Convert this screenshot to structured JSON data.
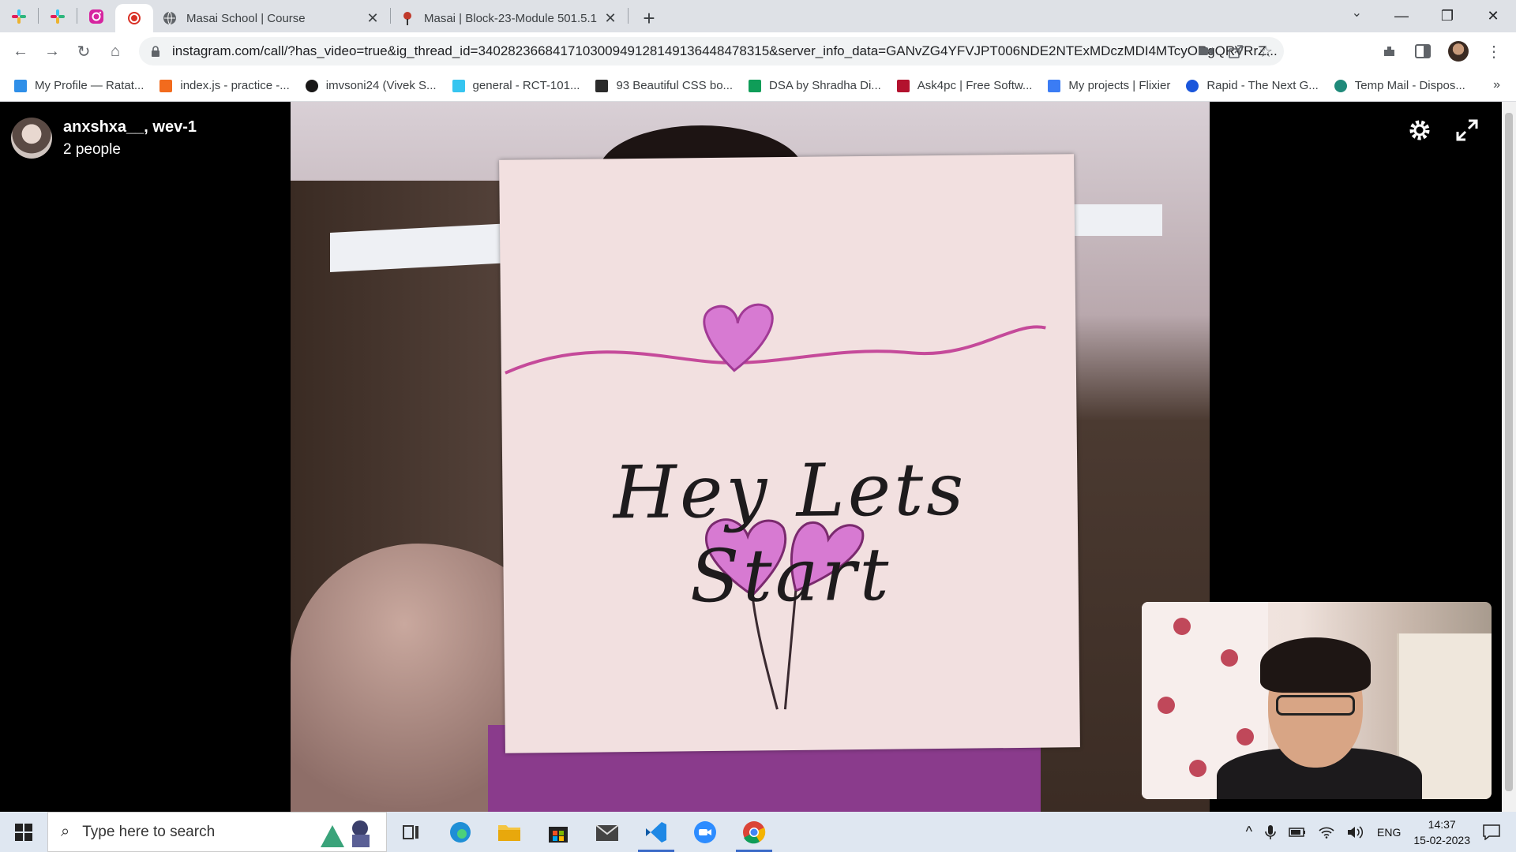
{
  "browser": {
    "tabs": [
      {
        "label": "Masai School | Course",
        "close": "✕"
      },
      {
        "label": "Masai | Block-23-Module 501.5.1",
        "close": "✕"
      }
    ],
    "new_tab": "+",
    "url": "instagram.com/call/?has_video=true&ig_thread_id=340282366841710300949128149136448478315&server_info_data=GANvZG4YFVJPT006NDE2NTExMDczMDI4MTcyORgQRVRrZ...",
    "bookmarks": [
      {
        "label": "My Profile — Ratat...",
        "color": "#2f8fe8"
      },
      {
        "label": "index.js - practice -...",
        "color": "#f26b1d"
      },
      {
        "label": "imvsoni24 (Vivek S...",
        "color": "#181717"
      },
      {
        "label": "general - RCT-101...",
        "color": "#36c5f0"
      },
      {
        "label": "93 Beautiful CSS bo...",
        "color": "#2b2b2b"
      },
      {
        "label": "DSA by Shradha Di...",
        "color": "#0f9d58"
      },
      {
        "label": "Ask4pc | Free Softw...",
        "color": "#b3122e"
      },
      {
        "label": "My projects | Flixier",
        "color": "#3b7cf4"
      },
      {
        "label": "Rapid - The Next G...",
        "color": "#1a56db"
      },
      {
        "label": "Temp Mail - Dispos...",
        "color": "#1f8a7a"
      }
    ],
    "bookmarks_more": "»"
  },
  "call": {
    "title": "anxshxa__, wev-1",
    "subtitle": "2 people",
    "note_text": "Hey Lets Start"
  },
  "taskbar": {
    "search_placeholder": "Type here to search",
    "language": "ENG",
    "time": "14:37",
    "date": "15-02-2023"
  }
}
